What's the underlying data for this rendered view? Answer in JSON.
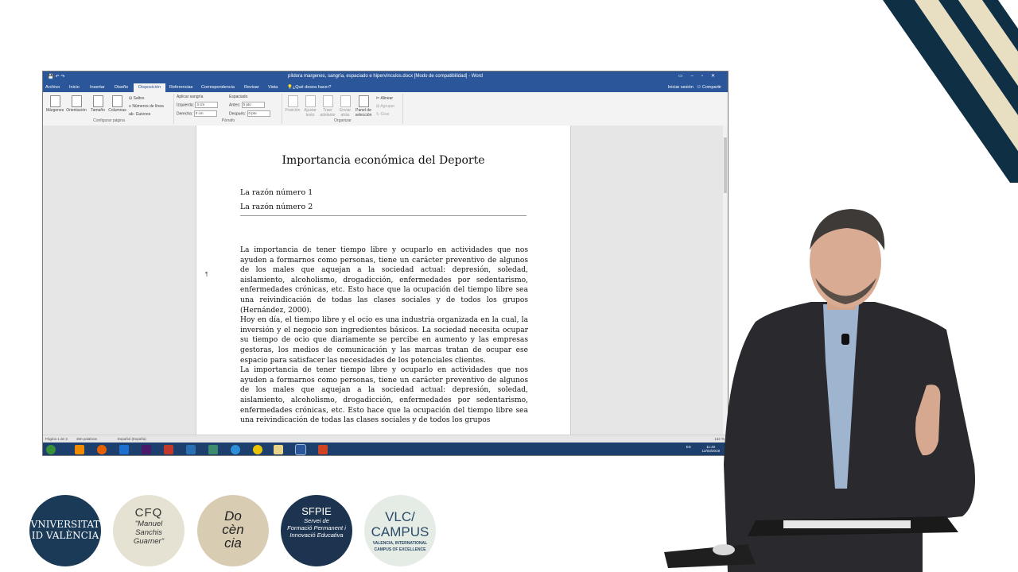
{
  "word": {
    "window_title": "píldora margenes, sangría, espaciado e hipervínculos.docx [Modo de compatibilidad] - Word",
    "tabs": [
      "Archivo",
      "Inicio",
      "Insertar",
      "Diseño",
      "Disposición",
      "Referencias",
      "Correspondencia",
      "Revisar",
      "Vista"
    ],
    "active_tab": "Disposición",
    "tell_me": "¿Qué desea hacer?",
    "sign_in": "Iniciar sesión",
    "share": "Compartir",
    "ribbon": {
      "margins": "Márgenes",
      "orientation": "Orientación",
      "size": "Tamaño",
      "columns": "Columnas",
      "breaks": "Saltos",
      "line_numbers": "Números de línea",
      "hyphenation": "Guiones",
      "group_page_setup": "Configurar página",
      "indent_label": "Aplicar sangría",
      "indent_left_label": "Izquierda:",
      "indent_left_value": "3 cm",
      "indent_right_label": "Derecha:",
      "indent_right_value": "0 cm",
      "spacing_label": "Espaciado",
      "spacing_before_label": "Antes:",
      "spacing_before_value": "0 pto",
      "spacing_after_label": "Después:",
      "spacing_after_value": "0 pto",
      "group_paragraph": "Párrafo",
      "position": "Posición",
      "wrap_text": "Ajustar texto",
      "bring_forward": "Traer adelante",
      "send_backward": "Enviar atrás",
      "selection_pane": "Panel de selección",
      "align": "Alinear",
      "group": "Agrupar",
      "rotate": "Girar",
      "group_arrange": "Organizar"
    },
    "document": {
      "title": "Importancia económica del Deporte",
      "toc": [
        "La razón número 1",
        "La razón número 2"
      ],
      "paragraphs": [
        "La importancia de tener tiempo libre y ocuparlo en actividades que nos ayuden a formarnos como personas, tiene un carácter preventivo de algunos de los males que aquejan a la sociedad actual: depresión, soledad, aislamiento, alcoholismo, drogadicción, enfermedades por sedentarismo, enfermedades crónicas, etc. Esto hace que la ocupación del tiempo libre sea una reivindicación de todas las clases sociales y de todos los grupos (Hernández, 2000).",
        "Hoy en día, el tiempo libre y el ocio es una industria organizada en la cual, la inversión y el negocio son ingredientes básicos. La sociedad necesita ocupar su tiempo de ocio que diariamente se percibe en aumento y las empresas gestoras, los medios de comunicación y las marcas tratan de ocupar ese espacio para satisfacer las necesidades de los potenciales clientes.",
        "La importancia de tener tiempo libre y ocuparlo en actividades que nos ayuden a formarnos como personas, tiene un carácter preventivo de algunos de los males que aquejan a la sociedad actual: depresión, soledad, aislamiento, alcoholismo, drogadicción, enfermedades por sedentarismo, enfermedades crónicas, etc. Esto hace que la ocupación del tiempo libre sea una reivindicación de todas las clases sociales y de todos los grupos"
      ],
      "pilcrow": "¶"
    },
    "status": {
      "page": "Página 1 de 3",
      "words": "350 palabras",
      "language": "Español (España)",
      "zoom": "132 %"
    },
    "taskbar": {
      "lang": "ES",
      "time": "11:40",
      "date": "12/03/2019"
    }
  },
  "logos": {
    "uv": [
      "VNIVERSITAT",
      "ID VALÈNCIA"
    ],
    "cfq": [
      "CFQ",
      "\"Manuel",
      "Sanchis",
      "Guarner\""
    ],
    "docencia": [
      "Do",
      "cèn",
      "cia"
    ],
    "sfpie": [
      "SFPIE",
      "Servei de",
      "Formació Permanent i",
      "Innovació Educativa"
    ],
    "vlc": [
      "VLC/",
      "CAMPUS",
      "VALENCIA, INTERNATIONAL",
      "CAMPUS OF EXCELLENCE"
    ]
  },
  "colors": {
    "word_blue": "#2b579a",
    "taskbar": "#1c3f6e",
    "stripe_navy": "#0f2f45",
    "stripe_cream": "#e8dfc3"
  }
}
